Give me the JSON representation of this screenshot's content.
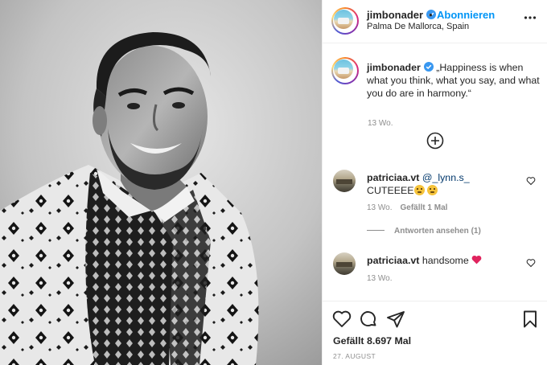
{
  "header": {
    "username": "jimbonader",
    "separator": "•",
    "follow_label": "Abonnieren",
    "location": "Palma De Mallorca, Spain"
  },
  "caption": {
    "username": "jimbonader",
    "text": "„Happiness is when what you think, what you say, and what you do are in harmony.“",
    "time": "13 Wo."
  },
  "comments": [
    {
      "username": "patriciaa.vt",
      "mention": "@_lynn.s_",
      "text": "CUTEEEE",
      "time": "13 Wo.",
      "likes": "Gefällt 1 Mal",
      "replies": "Antworten ansehen (1)"
    },
    {
      "username": "patriciaa.vt",
      "text": "handsome",
      "time": "13 Wo."
    }
  ],
  "footer": {
    "likes": "Gefällt 8.697 Mal",
    "date": "27. AUGUST"
  },
  "icons": {
    "verified": "verified-badge-icon",
    "more": "more-options-icon",
    "load_more": "plus-circle-icon",
    "comment_like": "heart-outline-icon",
    "like": "heart-icon",
    "comment": "comment-icon",
    "share": "paper-plane-icon",
    "save": "bookmark-icon"
  },
  "colors": {
    "link_blue": "#0095f6",
    "verified_blue": "#3897f0",
    "secondary_text": "#8e8e8e"
  }
}
